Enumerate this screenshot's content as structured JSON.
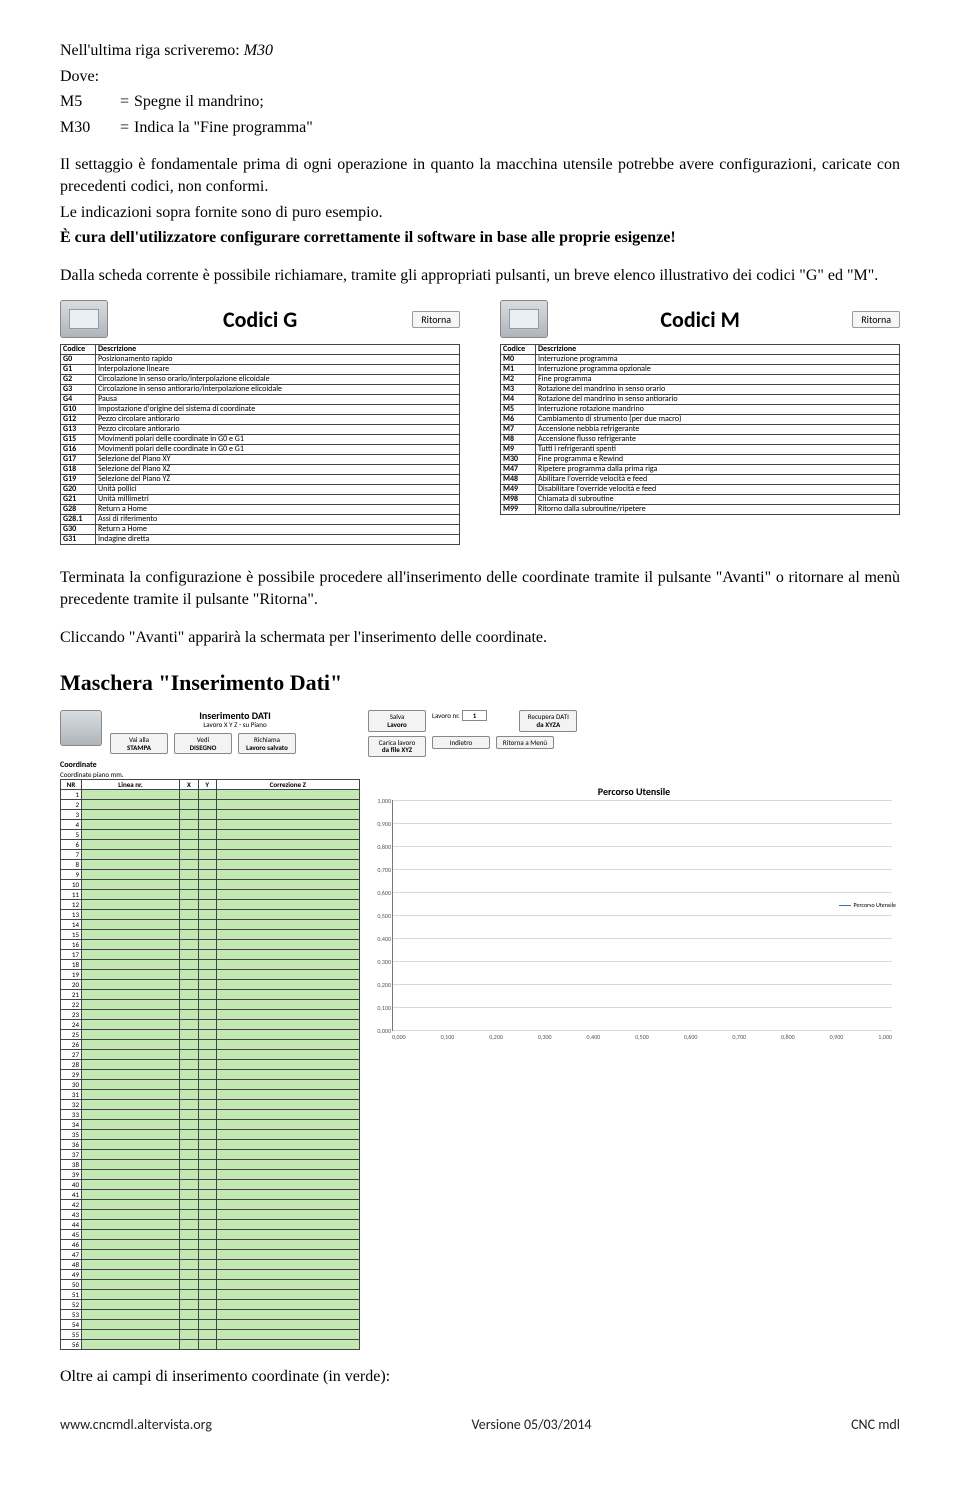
{
  "intro": {
    "line1a": "Nell'ultima riga scriveremo: ",
    "line1b_italic": "M30",
    "dove": "Dove:",
    "defs": [
      {
        "code": "M5",
        "text": "Spegne il mandrino;"
      },
      {
        "code": "M30",
        "text": "Indica la \"Fine programma\""
      }
    ],
    "para1": "Il settaggio è fondamentale prima di ogni operazione in quanto la macchina utensile potrebbe avere configurazioni, caricate con precedenti codici, non conformi.",
    "para2": "Le indicazioni sopra fornite sono di puro esempio.",
    "para3_bold": "È cura dell'utilizzatore configurare correttamente il software in base alle proprie esigenze!",
    "para4": "Dalla scheda corrente è possibile richiamare, tramite gli appropriati pulsanti, un breve elenco illustrativo dei codici \"G\" ed \"M\"."
  },
  "thumbG": {
    "title": "Codici G",
    "ritorna": "Ritorna",
    "head_code": "Codice",
    "head_desc": "Descrizione",
    "rows": [
      {
        "c": "G0",
        "d": "Posizionamento rapido"
      },
      {
        "c": "G1",
        "d": "Interpolazione lineare"
      },
      {
        "c": "G2",
        "d": "Circolazione in senso orario/interpolazione elicoidale"
      },
      {
        "c": "G3",
        "d": "Circolazione in senso antiorario/interpolazione elicoidale"
      },
      {
        "c": "G4",
        "d": "Pausa"
      },
      {
        "c": "G10",
        "d": "Impostazione d'origine del sistema di coordinate"
      },
      {
        "c": "G12",
        "d": "Pezzo circolare antiorario"
      },
      {
        "c": "G13",
        "d": "Pezzo circolare antiorario"
      },
      {
        "c": "G15",
        "d": "Movimenti polari delle coordinate in G0 e G1"
      },
      {
        "c": "G16",
        "d": "Movimenti polari delle coordinate in G0 e G1"
      },
      {
        "c": "G17",
        "d": "Selezione del Piano XY"
      },
      {
        "c": "G18",
        "d": "Selezione del Piano XZ"
      },
      {
        "c": "G19",
        "d": "Selezione del Piano YZ"
      },
      {
        "c": "G20",
        "d": "Unità pollici"
      },
      {
        "c": "G21",
        "d": "Unità millimetri"
      },
      {
        "c": "G28",
        "d": "Return a Home"
      },
      {
        "c": "G28.1",
        "d": "Assi di riferimento"
      },
      {
        "c": "G30",
        "d": "Return a Home"
      },
      {
        "c": "G31",
        "d": "Indagine diretta"
      }
    ]
  },
  "thumbM": {
    "title": "Codici M",
    "ritorna": "Ritorna",
    "head_code": "Codice",
    "head_desc": "Descrizione",
    "rows": [
      {
        "c": "M0",
        "d": "Interruzione programma"
      },
      {
        "c": "M1",
        "d": "Interruzione programma opzionale"
      },
      {
        "c": "M2",
        "d": "Fine programma"
      },
      {
        "c": "M3",
        "d": "Rotazione del mandrino in senso orario"
      },
      {
        "c": "M4",
        "d": "Rotazione del mandrino in senso antiorario"
      },
      {
        "c": "M5",
        "d": "Interruzione rotazione mandrino"
      },
      {
        "c": "M6",
        "d": "Cambiamento di strumento (per due macro)"
      },
      {
        "c": "M7",
        "d": "Accensione nebbia refrigerante"
      },
      {
        "c": "M8",
        "d": "Accensione flusso refrigerante"
      },
      {
        "c": "M9",
        "d": "Tutti i refrigeranti spenti"
      },
      {
        "c": "M30",
        "d": "Fine programma e Rewind"
      },
      {
        "c": "M47",
        "d": "Ripetere programma dalla prima riga"
      },
      {
        "c": "M48",
        "d": "Abilitare l'override velocità e feed"
      },
      {
        "c": "M49",
        "d": "Disabilitare l'override velocità e feed"
      },
      {
        "c": "M98",
        "d": "Chiamata di subroutine"
      },
      {
        "c": "M99",
        "d": "Ritorno dalla subroutine/ripetere"
      }
    ]
  },
  "body2": {
    "para5": "Terminata la configurazione è possibile procedere all'inserimento delle coordinate tramite il pulsante \"Avanti\" o ritornare al menù precedente tramite il pulsante \"Ritorna\".",
    "para6": "Cliccando \"Avanti\" apparirà la schermata per l'inserimento delle coordinate.",
    "h2": "Maschera \"Inserimento Dati\""
  },
  "insdati": {
    "title_a": "Inserimento DATI",
    "title_b": "Lavoro X Y Z - su Piano",
    "btns": {
      "b1a": "Vai alla",
      "b1b": "STAMPA",
      "b2a": "Vedi",
      "b2b": "DISEGNO",
      "b3a": "Richiama",
      "b3b": "Lavoro salvato",
      "b4a": "Salva",
      "b4b": "Lavoro",
      "b5a": "Lavoro nr.",
      "b5b": "1",
      "b6a": "Carica lavoro",
      "b6b": "da file XYZ",
      "b7": "Indietro",
      "b8": "Ritorna a Menù",
      "b9a": "Recupera DATI",
      "b9b": "da XYZA"
    },
    "coord_label": "Coordinate",
    "coord_sub": "Coordinate piano mm.",
    "headers": [
      "NR",
      "Linea nr.",
      "X",
      "Y",
      "Correzione Z"
    ],
    "rows_count": 56,
    "chart_title": "Percorso Utensile",
    "legend": "Percorso Utensile"
  },
  "chart_data": {
    "type": "line",
    "title": "Percorso Utensile",
    "xlabel": "",
    "ylabel": "",
    "x_ticks": [
      "0,000",
      "0,100",
      "0,200",
      "0,300",
      "0,400",
      "0,500",
      "0,600",
      "0,700",
      "0,800",
      "0,900",
      "1,000"
    ],
    "y_ticks": [
      "0,000",
      "0,100",
      "0,200",
      "0,300",
      "0,400",
      "0,500",
      "0,600",
      "0,700",
      "0,800",
      "0,900",
      "1,000"
    ],
    "xlim": [
      0,
      1
    ],
    "ylim": [
      0,
      1
    ],
    "series": [
      {
        "name": "Percorso Utensile",
        "values": []
      }
    ]
  },
  "outro": {
    "line": "Oltre ai campi di inserimento coordinate (in verde):"
  },
  "footer": {
    "left": "www.cncmdl.altervista.org",
    "center": "Versione 05/03/2014",
    "right": "CNC mdl"
  }
}
